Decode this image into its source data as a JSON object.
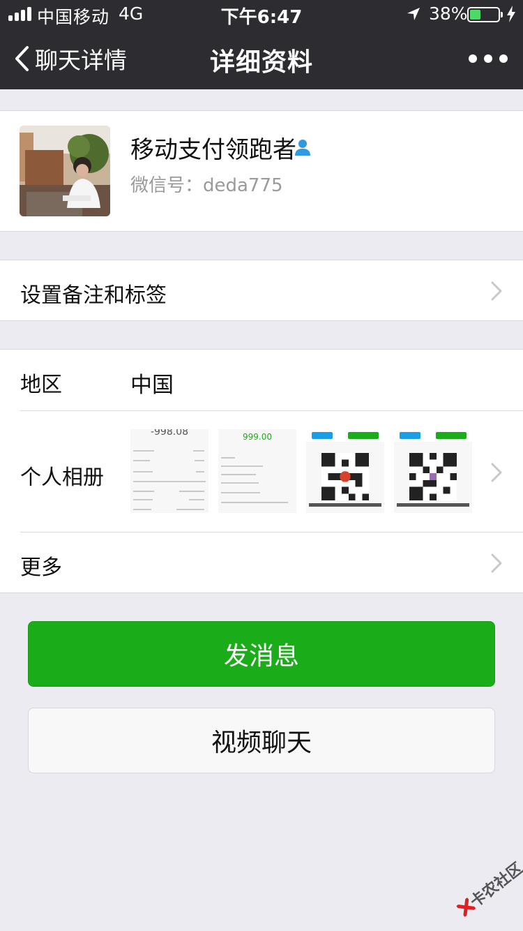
{
  "status_bar": {
    "carrier": "中国移动",
    "network": "4G",
    "time": "下午6:47",
    "battery_percent": "38%",
    "battery_level": 0.38
  },
  "nav": {
    "back_label": "聊天详情",
    "title": "详细资料"
  },
  "profile": {
    "name": "移动支付领跑者",
    "wechat_id": "微信号：deda775"
  },
  "remark_row": {
    "label": "设置备注和标签"
  },
  "region_row": {
    "label": "地区",
    "value": "中国"
  },
  "album_row": {
    "label": "个人相册",
    "thumbnails": [
      {
        "headline": "-998.08"
      },
      {
        "headline": "999.00"
      },
      {
        "headline": ""
      },
      {
        "headline": ""
      }
    ]
  },
  "more_row": {
    "label": "更多"
  },
  "buttons": {
    "send_message": "发消息",
    "video_chat": "视频聊天"
  },
  "watermark": "卡农社区",
  "colors": {
    "nav_bg": "#2d2c31",
    "page_bg": "#ebebf1",
    "primary_green": "#1aad19",
    "battery_green": "#4cd964"
  }
}
